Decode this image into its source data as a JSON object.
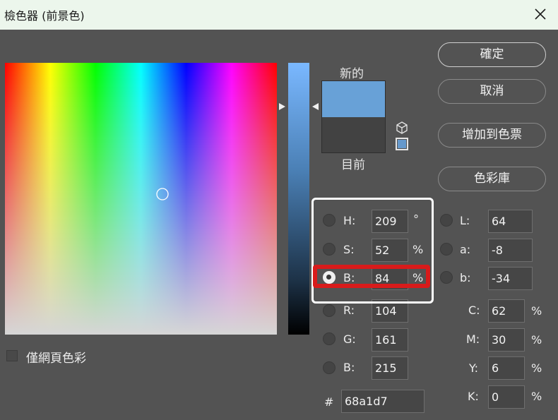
{
  "window": {
    "title": "檢色器 (前景色)",
    "close_icon": "close-icon"
  },
  "preview": {
    "new_label": "新的",
    "current_label": "目前",
    "new_color": "#68a1d7",
    "current_color": "#424242",
    "websafe_color": "#6699cc"
  },
  "buttons": {
    "ok": "確定",
    "cancel": "取消",
    "add_swatch": "增加到色票",
    "libraries": "色彩庫"
  },
  "hsb": {
    "h": {
      "label": "H:",
      "value": "209",
      "unit": "°"
    },
    "s": {
      "label": "S:",
      "value": "52",
      "unit": "%"
    },
    "b": {
      "label": "B:",
      "value": "84",
      "unit": "%"
    }
  },
  "rgb": {
    "r": {
      "label": "R:",
      "value": "104"
    },
    "g": {
      "label": "G:",
      "value": "161"
    },
    "b": {
      "label": "B:",
      "value": "215"
    }
  },
  "lab": {
    "l": {
      "label": "L:",
      "value": "64"
    },
    "a": {
      "label": "a:",
      "value": "-8"
    },
    "b": {
      "label": "b:",
      "value": "-34"
    }
  },
  "cmyk": {
    "c": {
      "label": "C:",
      "value": "62",
      "unit": "%"
    },
    "m": {
      "label": "M:",
      "value": "30",
      "unit": "%"
    },
    "y": {
      "label": "Y:",
      "value": "6",
      "unit": "%"
    },
    "k": {
      "label": "K:",
      "value": "0",
      "unit": "%"
    }
  },
  "hex": {
    "label": "#",
    "value": "68a1d7"
  },
  "web_colors_only": {
    "label": "僅網頁色彩",
    "checked": false
  },
  "selected_mode": "B",
  "annotation_colors": {
    "white_box": "#ffffff",
    "red_box": "#d81b1b"
  }
}
